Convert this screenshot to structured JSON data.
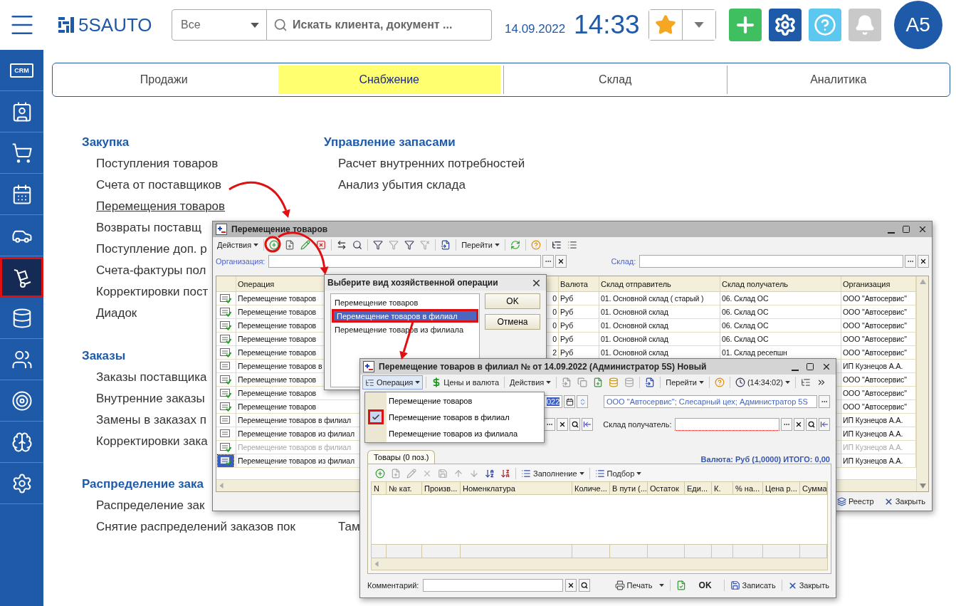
{
  "header": {
    "logo": "**5S**AUTO",
    "scope_select": {
      "value": "Все"
    },
    "search": {
      "placeholder": "Искать клиента, документ ..."
    },
    "date": "14.09.2022",
    "time": "14:33",
    "avatar": "A5"
  },
  "sidebar": {
    "items": [
      {
        "label": "CRM",
        "selected": false
      },
      {
        "selected": false
      },
      {
        "selected": false
      },
      {
        "selected": false
      },
      {
        "selected": false
      },
      {
        "selected": true
      },
      {
        "selected": false
      },
      {
        "selected": false
      },
      {
        "selected": false
      },
      {
        "selected": false
      },
      {
        "selected": false
      }
    ]
  },
  "tabs": [
    {
      "label": "Продажи",
      "selected": false
    },
    {
      "label": "Снабжение",
      "selected": true
    },
    {
      "label": "Склад",
      "selected": false
    },
    {
      "label": "Аналитика",
      "selected": false
    }
  ],
  "menu": {
    "rows": [
      {
        "sections": [
          {
            "title": "Закупка",
            "items": [
              {
                "label": "Поступления товаров",
                "selected": false
              },
              {
                "label": "Счета от поставщиков",
                "selected": false
              },
              {
                "label": "Перемещения товаров",
                "selected": true
              },
              {
                "label": "Возвраты поставщ",
                "selected": false
              },
              {
                "label": "Поступление доп. р",
                "selected": false
              },
              {
                "label": "Счета-фактуры пол",
                "selected": false
              },
              {
                "label": "Корректировки пост",
                "selected": false
              },
              {
                "label": "Диадок",
                "selected": false
              }
            ]
          },
          {
            "title": "Управление запасами",
            "items": [
              {
                "label": "Расчет внутренних потребностей",
                "selected": false
              },
              {
                "label": "Анализ убытия склада",
                "selected": false
              }
            ]
          }
        ]
      },
      {
        "sections": [
          {
            "title": "Заказы",
            "items": [
              {
                "label": "Заказы поставщика",
                "selected": false
              },
              {
                "label": "Внутренние заказы",
                "selected": false
              },
              {
                "label": "Замены в заказах п",
                "selected": false
              },
              {
                "label": "Корректировки зака",
                "selected": false
              }
            ]
          }
        ]
      },
      {
        "sections": [
          {
            "title": "Распределение зака",
            "items": [
              {
                "label": "Распределение зак",
                "selected": false
              },
              {
                "label": "Снятие распределений заказов пок",
                "selected": false
              }
            ]
          },
          {
            "items": [
              {
                "label": "Там",
                "selected": false
              }
            ]
          }
        ]
      }
    ]
  },
  "list_window": {
    "title": "Перемещение товаров",
    "toolbar": {
      "actions": "Действия",
      "goto": "Перейти"
    },
    "filters": {
      "organization": "Организация:",
      "warehouse": "Склад:"
    },
    "table": {
      "columns": {
        "operation": "Операция",
        "currency": "Валюта",
        "sender": "Склад отправитель",
        "receiver": "Склад получатель",
        "organization": "Организация"
      },
      "rows": [
        {
          "posted": true,
          "selected": false,
          "greyed": false,
          "operation": "Перемещение товаров",
          "column_3": "0",
          "currency": "Руб",
          "sender": "01.  Основной склад ( старый )",
          "receiver": "06. Склад ОС",
          "organization": "ООО \"Автосервис\""
        },
        {
          "posted": true,
          "selected": false,
          "greyed": false,
          "operation": "Перемещение товаров",
          "column_3": "0",
          "currency": "Руб",
          "sender": "01.  Основной склад",
          "receiver": "06. Склад ОС",
          "organization": "ООО \"Автосервис\""
        },
        {
          "posted": true,
          "selected": false,
          "greyed": false,
          "operation": "Перемещение товаров",
          "column_3": "0",
          "currency": "Руб",
          "sender": "01.  Основной склад",
          "receiver": "06. Склад ОС",
          "organization": "ООО \"Автосервис\""
        },
        {
          "posted": true,
          "selected": false,
          "greyed": false,
          "operation": "Перемещение товаров",
          "column_3": "0",
          "currency": "Руб",
          "sender": "01.  Основной склад",
          "receiver": "06. Склад ОС",
          "organization": "ООО \"Автосервис\""
        },
        {
          "posted": true,
          "selected": false,
          "greyed": false,
          "operation": "Перемещение товаров",
          "column_3": "2",
          "currency": "Руб",
          "sender": "01.  Основной склад",
          "receiver": "01. Склад ресепшн",
          "organization": "ООО \"Автосервис\""
        },
        {
          "posted": false,
          "selected": false,
          "greyed": false,
          "operation": "Перемещение товаров в",
          "organization": "ИП Кузнецов А.А."
        },
        {
          "posted": true,
          "selected": false,
          "greyed": false,
          "operation": "Перемещение товаров",
          "organization": "ООО \"Автосервис\""
        },
        {
          "posted": true,
          "selected": false,
          "greyed": false,
          "operation": "Перемещение товаров",
          "organization": "ООО \"Автосервис\""
        },
        {
          "posted": true,
          "selected": false,
          "greyed": false,
          "operation": "Перемещение товаров",
          "organization": "ООО \"Автосервис\""
        },
        {
          "posted": false,
          "selected": false,
          "greyed": false,
          "operation": "Перемещение товаров в филиал",
          "organization": "ИП Кузнецов А.А."
        },
        {
          "posted": false,
          "selected": false,
          "greyed": false,
          "operation": "Перемещение товаров из филиал",
          "organization": "ИП Кузнецов А.А."
        },
        {
          "posted": true,
          "selected": false,
          "greyed": true,
          "operation": "Перемещение товаров в филиал",
          "organization": "ИП Кузнецов А.А."
        },
        {
          "posted": true,
          "selected": true,
          "greyed": false,
          "operation": "Перемещение товаров из филиал",
          "organization": "ИП Кузнецов А.А."
        }
      ]
    },
    "footer_buttons": {
      "registry": "Реестр",
      "close": "Закрыть"
    }
  },
  "dialog": {
    "title": "Выберите вид хозяйственной операции",
    "options": [
      {
        "label": "Перемещение товаров",
        "selected": false
      },
      {
        "label": "Перемещение товаров в филиал",
        "selected": true
      },
      {
        "label": "Перемещение товаров из филиала",
        "selected": false
      }
    ],
    "buttons": {
      "ok": "OK",
      "cancel": "Отмена"
    }
  },
  "document_window": {
    "title": "Перемещение товаров в филиал №  от 14.09.2022 (Администратор 5S) Новый",
    "toolbar": {
      "operation": "Операция",
      "prices": "Цены и валюта",
      "actions": "Действия",
      "goto": "Перейти",
      "time": "(14:34:02)"
    },
    "date_value": "022",
    "organization_value": "ООО \"Автосервис\"; Слесарный цех; Администратор 5S",
    "receiver_label": "Склад получатель:",
    "tab": "Товары (0 поз.)",
    "totals": "Валюта: Руб (1,0000) ИТОГО: 0,00",
    "table_toolbar": {
      "fill": "Заполнение",
      "pick": "Подбор"
    },
    "columns": [
      "N",
      "№ кат.",
      "Произв...",
      "Номенклатура",
      "Количе...",
      "В пути (...",
      "Остаток",
      "Еди...",
      "К.",
      "% на...",
      "Цена р...",
      "Сумма"
    ],
    "comment_label": "Комментарий:",
    "buttons": {
      "print": "Печать",
      "ok": "OK",
      "save": "Записать",
      "close": "Закрыть"
    }
  },
  "operation_menu": {
    "items": [
      {
        "label": "Перемещение товаров",
        "checked": false
      },
      {
        "label": "Перемещение товаров в филиал",
        "checked": true
      },
      {
        "label": "Перемещение товаров из филиала",
        "checked": false
      }
    ]
  }
}
